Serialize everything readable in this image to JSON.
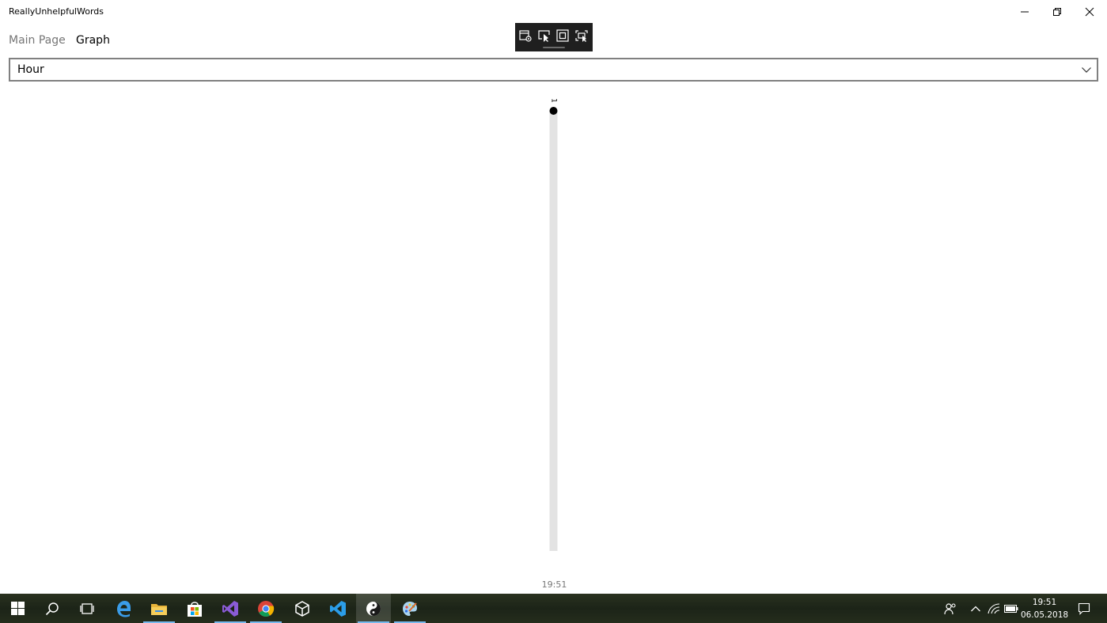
{
  "window": {
    "title": "ReallyUnhelpfulWords",
    "controls": {
      "minimize": "minimize-icon",
      "maximize": "restore-icon",
      "close": "close-icon"
    }
  },
  "nav": {
    "items": [
      {
        "label": "Main Page",
        "active": false
      },
      {
        "label": "Graph",
        "active": true
      }
    ]
  },
  "debug_toolbar": {
    "buttons": [
      "live-visual-tree-icon",
      "select-element-icon",
      "display-layout-adorners-icon",
      "track-focused-element-icon"
    ]
  },
  "period_selector": {
    "selected": "Hour"
  },
  "chart_data": {
    "type": "bar",
    "categories": [
      "19:51"
    ],
    "values": [
      1
    ],
    "data_labels": [
      "1"
    ],
    "ylim": [
      0,
      1
    ],
    "grid": false,
    "colors": {
      "bar": "#e3e3e3",
      "point": "#000000",
      "tick_label": "#767676"
    }
  },
  "taskbar": {
    "apps": [
      "windows-start-icon",
      "search-icon",
      "task-view-icon",
      "edge-icon",
      "file-explorer-icon",
      "store-icon",
      "visual-studio-icon",
      "chrome-icon",
      "unity-icon",
      "vscode-icon",
      "yin-yang-app-icon",
      "paint-app-icon"
    ],
    "time": "19:51",
    "date": "06.05.2018"
  }
}
